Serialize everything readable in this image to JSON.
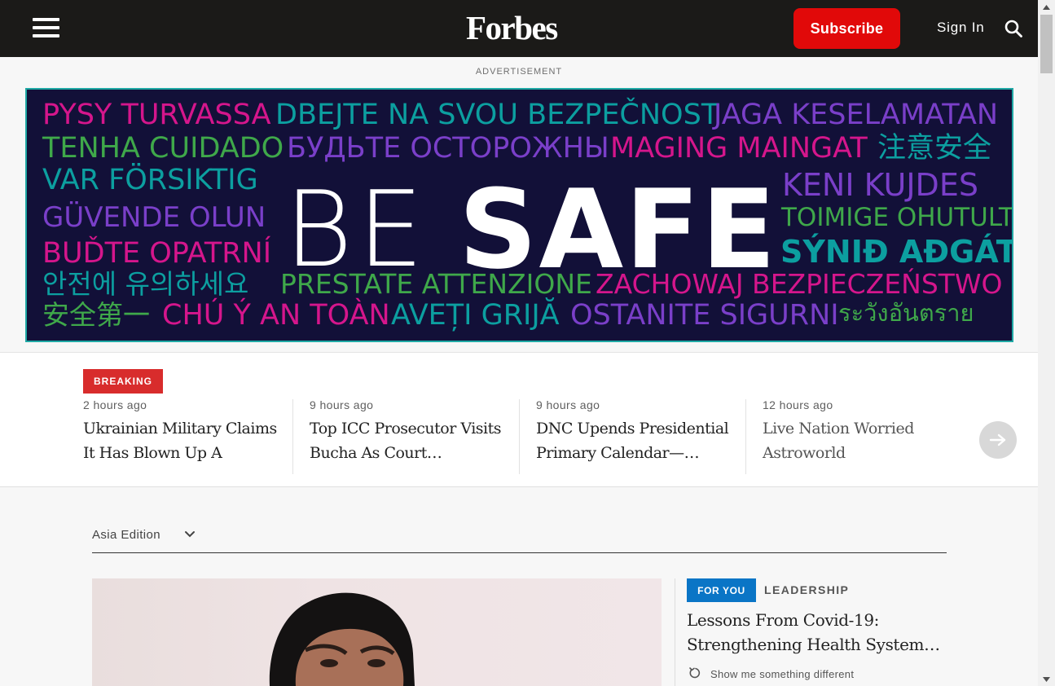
{
  "nav": {
    "logo": "Forbes",
    "subscribe_label": "Subscribe",
    "signin_label": "Sign In",
    "colors": {
      "background": "#1b1a18",
      "subscribe": "#e10909"
    }
  },
  "ad": {
    "label": "ADVERTISEMENT",
    "headline_be": "BE",
    "headline_safe": "SAFE",
    "phrases": [
      "PYSY TURVASSA",
      "DBEJTE NA SVOU BEZPEČNOST",
      "JAGA KESELAMATAN",
      "TENHA CUIDADO",
      "БУДЬТЕ ОСТОРОЖНЫ",
      "MAGING MAINGAT",
      "注意安全",
      "VAR FÖRSIKTIG",
      "KENI KUJDES",
      "GÜVENDE OLUN",
      "TOIMIGE OHUTULT",
      "BUĎTE OPATRNÍ",
      "SÝNIÐ AÐGÁT",
      "안전에 유의하세요",
      "PRESTATE ATTENZIONE",
      "ZACHOWAJ BEZPIECZEŃSTWO",
      "安全第一",
      "CHÚ Ý AN TOÀN",
      "AVEȚI GRIJĂ",
      "OSTANITE SIGURNI",
      "ระวังอันตราย"
    ]
  },
  "breaking": {
    "badge": "BREAKING",
    "stories": [
      {
        "time": "2 hours ago",
        "headline": "Ukrainian Military Claims It Has Blown Up A Bridge…"
      },
      {
        "time": "9 hours ago",
        "headline": "Top ICC Prosecutor Visits Bucha As Court…"
      },
      {
        "time": "9 hours ago",
        "headline": "DNC Upends Presidential Primary Calendar—…"
      },
      {
        "time": "12 hours ago",
        "headline": "Live Nation Worried Astroworld Documentary…"
      }
    ],
    "next_icon": "arrow-right-icon"
  },
  "edition": {
    "selected": "Asia Edition"
  },
  "feature": {
    "tag": "FOR YOU",
    "category": "LEADERSHIP",
    "headline": "Lessons From Covid-19: Strengthening Health System…",
    "action": "Show me something different"
  }
}
